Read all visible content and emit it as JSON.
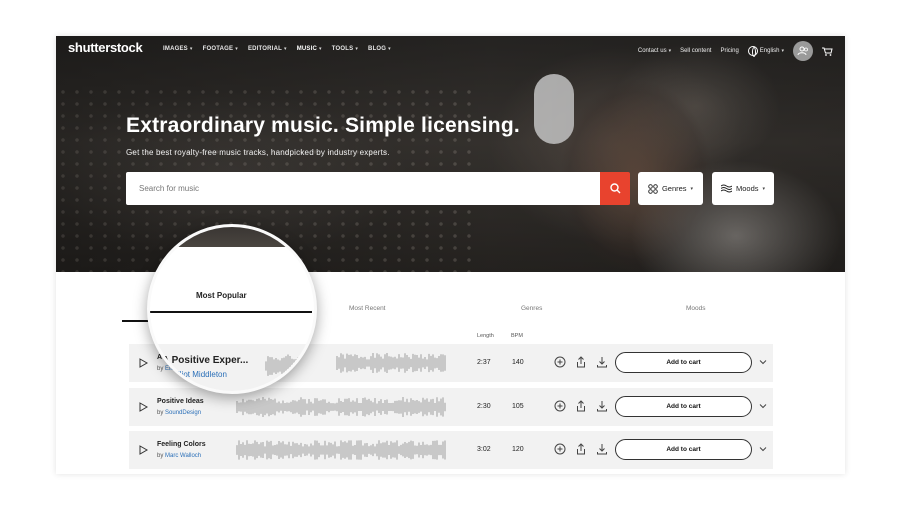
{
  "nav": {
    "logo": "shutterstock",
    "menu": [
      {
        "label": "IMAGES",
        "active": false
      },
      {
        "label": "FOOTAGE",
        "active": false
      },
      {
        "label": "EDITORIAL",
        "active": false
      },
      {
        "label": "MUSIC",
        "active": true
      },
      {
        "label": "TOOLS",
        "active": false
      },
      {
        "label": "BLOG",
        "active": false
      }
    ],
    "contact": "Contact us",
    "sell": "Sell content",
    "pricing": "Pricing",
    "language": "English"
  },
  "hero": {
    "headline": "Extraordinary music. Simple licensing.",
    "subhead": "Get the best royalty-free music tracks, handpicked by industry experts.",
    "search_placeholder": "Search for music",
    "genres_label": "Genres",
    "moods_label": "Moods"
  },
  "tabs": {
    "most_popular": "Most Popular",
    "most_recent": "Most Recent",
    "genres": "Genres",
    "moods": "Moods"
  },
  "columns": {
    "length": "Length",
    "bpm": "BPM"
  },
  "tracks": [
    {
      "title": "A Positive Exper...",
      "by": "by",
      "artist": "Elliot Middleton",
      "length": "2:37",
      "bpm": "140",
      "cart": "Add to cart"
    },
    {
      "title": "Positive Ideas",
      "by": "by",
      "artist": "SoundDesign",
      "length": "2:30",
      "bpm": "105",
      "cart": "Add to cart"
    },
    {
      "title": "Feeling Colors",
      "by": "by",
      "artist": "Marc Walloch",
      "length": "3:02",
      "bpm": "120",
      "cart": "Add to cart"
    }
  ],
  "colors": {
    "accent": "#e8432e",
    "link": "#2a6fb8",
    "row_bg": "#f2f2f2"
  }
}
